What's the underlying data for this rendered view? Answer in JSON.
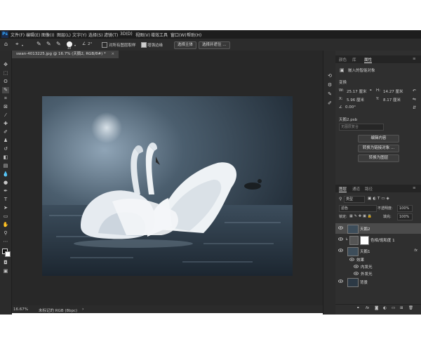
{
  "menubar": {
    "items": [
      "文件(F)",
      "编辑(E)",
      "图像(I)",
      "图层(L)",
      "文字(Y)",
      "选择(S)",
      "滤镜(T)",
      "3D(D)",
      "视图(V)",
      "增效工具",
      "窗口(W)",
      "帮助(H)"
    ]
  },
  "options": {
    "brush_size": "30",
    "angle": "2°",
    "sample_all_layers": "对所有图层取样",
    "enhance_edge": "增强边缘",
    "select_subject": "选择主体",
    "select_and_mask": "选择并遮住 ..."
  },
  "document": {
    "tab_title": "swan-4013225.jpg @ 16.7% (天鹅2, RGB/8#) *",
    "zoom": "16.67%",
    "profile": "未标记的 RGB (8bpc)"
  },
  "properties": {
    "tabs": [
      "颜色",
      "库",
      "属性"
    ],
    "object_type": "嵌入的智能对象",
    "transform_label": "变换",
    "w_label": "W:",
    "w_value": "25.17 厘米",
    "h_label": "H:",
    "h_value": "14.27 厘米",
    "x_label": "X:",
    "x_value": "5.96 厘米",
    "y_label": "Y:",
    "y_value": "8.17 厘米",
    "angle_value": "0.00°",
    "file_name": "天鹅2.psb",
    "layer_comp": "无图层复合",
    "edit_contents": "编辑内容",
    "convert_linked": "转换为链接对象 ...",
    "convert_layers": "转换为图层"
  },
  "layers": {
    "tabs": [
      "图层",
      "通道",
      "路径"
    ],
    "filter_kind": "类型",
    "blend_mode": "滤色",
    "opacity_label": "不透明度:",
    "opacity_value": "100%",
    "lock_label": "锁定:",
    "fill_label": "填充:",
    "fill_value": "100%",
    "rows": [
      {
        "name": "天鹅2"
      },
      {
        "name": "色相/饱和度 1"
      },
      {
        "name": "天鹅1",
        "fx": "fx"
      },
      {
        "name": "效果"
      },
      {
        "name": "内发光"
      },
      {
        "name": "外发光"
      },
      {
        "name": "背景"
      }
    ],
    "footer_fx": "fx"
  },
  "colors": {
    "app_bg": "#282828",
    "panel_bg": "#2f2f2f",
    "selected_row": "#4b4b4b",
    "accent": "#31a8ff"
  }
}
